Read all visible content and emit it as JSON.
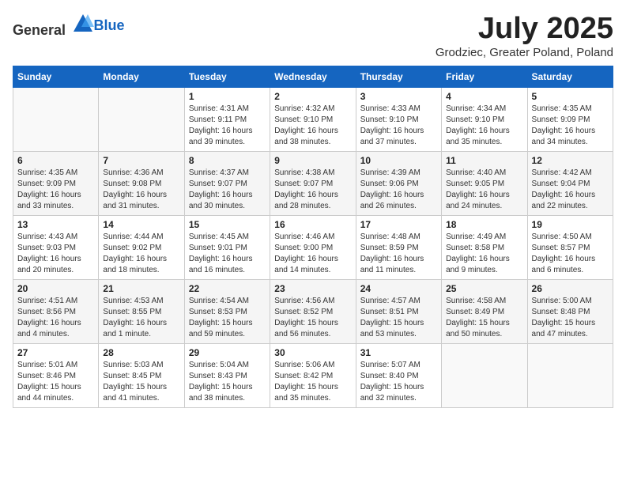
{
  "header": {
    "logo_general": "General",
    "logo_blue": "Blue",
    "month_year": "July 2025",
    "location": "Grodziec, Greater Poland, Poland"
  },
  "days_of_week": [
    "Sunday",
    "Monday",
    "Tuesday",
    "Wednesday",
    "Thursday",
    "Friday",
    "Saturday"
  ],
  "weeks": [
    [
      {
        "day": "",
        "info": ""
      },
      {
        "day": "",
        "info": ""
      },
      {
        "day": "1",
        "info": "Sunrise: 4:31 AM\nSunset: 9:11 PM\nDaylight: 16 hours and 39 minutes."
      },
      {
        "day": "2",
        "info": "Sunrise: 4:32 AM\nSunset: 9:10 PM\nDaylight: 16 hours and 38 minutes."
      },
      {
        "day": "3",
        "info": "Sunrise: 4:33 AM\nSunset: 9:10 PM\nDaylight: 16 hours and 37 minutes."
      },
      {
        "day": "4",
        "info": "Sunrise: 4:34 AM\nSunset: 9:10 PM\nDaylight: 16 hours and 35 minutes."
      },
      {
        "day": "5",
        "info": "Sunrise: 4:35 AM\nSunset: 9:09 PM\nDaylight: 16 hours and 34 minutes."
      }
    ],
    [
      {
        "day": "6",
        "info": "Sunrise: 4:35 AM\nSunset: 9:09 PM\nDaylight: 16 hours and 33 minutes."
      },
      {
        "day": "7",
        "info": "Sunrise: 4:36 AM\nSunset: 9:08 PM\nDaylight: 16 hours and 31 minutes."
      },
      {
        "day": "8",
        "info": "Sunrise: 4:37 AM\nSunset: 9:07 PM\nDaylight: 16 hours and 30 minutes."
      },
      {
        "day": "9",
        "info": "Sunrise: 4:38 AM\nSunset: 9:07 PM\nDaylight: 16 hours and 28 minutes."
      },
      {
        "day": "10",
        "info": "Sunrise: 4:39 AM\nSunset: 9:06 PM\nDaylight: 16 hours and 26 minutes."
      },
      {
        "day": "11",
        "info": "Sunrise: 4:40 AM\nSunset: 9:05 PM\nDaylight: 16 hours and 24 minutes."
      },
      {
        "day": "12",
        "info": "Sunrise: 4:42 AM\nSunset: 9:04 PM\nDaylight: 16 hours and 22 minutes."
      }
    ],
    [
      {
        "day": "13",
        "info": "Sunrise: 4:43 AM\nSunset: 9:03 PM\nDaylight: 16 hours and 20 minutes."
      },
      {
        "day": "14",
        "info": "Sunrise: 4:44 AM\nSunset: 9:02 PM\nDaylight: 16 hours and 18 minutes."
      },
      {
        "day": "15",
        "info": "Sunrise: 4:45 AM\nSunset: 9:01 PM\nDaylight: 16 hours and 16 minutes."
      },
      {
        "day": "16",
        "info": "Sunrise: 4:46 AM\nSunset: 9:00 PM\nDaylight: 16 hours and 14 minutes."
      },
      {
        "day": "17",
        "info": "Sunrise: 4:48 AM\nSunset: 8:59 PM\nDaylight: 16 hours and 11 minutes."
      },
      {
        "day": "18",
        "info": "Sunrise: 4:49 AM\nSunset: 8:58 PM\nDaylight: 16 hours and 9 minutes."
      },
      {
        "day": "19",
        "info": "Sunrise: 4:50 AM\nSunset: 8:57 PM\nDaylight: 16 hours and 6 minutes."
      }
    ],
    [
      {
        "day": "20",
        "info": "Sunrise: 4:51 AM\nSunset: 8:56 PM\nDaylight: 16 hours and 4 minutes."
      },
      {
        "day": "21",
        "info": "Sunrise: 4:53 AM\nSunset: 8:55 PM\nDaylight: 16 hours and 1 minute."
      },
      {
        "day": "22",
        "info": "Sunrise: 4:54 AM\nSunset: 8:53 PM\nDaylight: 15 hours and 59 minutes."
      },
      {
        "day": "23",
        "info": "Sunrise: 4:56 AM\nSunset: 8:52 PM\nDaylight: 15 hours and 56 minutes."
      },
      {
        "day": "24",
        "info": "Sunrise: 4:57 AM\nSunset: 8:51 PM\nDaylight: 15 hours and 53 minutes."
      },
      {
        "day": "25",
        "info": "Sunrise: 4:58 AM\nSunset: 8:49 PM\nDaylight: 15 hours and 50 minutes."
      },
      {
        "day": "26",
        "info": "Sunrise: 5:00 AM\nSunset: 8:48 PM\nDaylight: 15 hours and 47 minutes."
      }
    ],
    [
      {
        "day": "27",
        "info": "Sunrise: 5:01 AM\nSunset: 8:46 PM\nDaylight: 15 hours and 44 minutes."
      },
      {
        "day": "28",
        "info": "Sunrise: 5:03 AM\nSunset: 8:45 PM\nDaylight: 15 hours and 41 minutes."
      },
      {
        "day": "29",
        "info": "Sunrise: 5:04 AM\nSunset: 8:43 PM\nDaylight: 15 hours and 38 minutes."
      },
      {
        "day": "30",
        "info": "Sunrise: 5:06 AM\nSunset: 8:42 PM\nDaylight: 15 hours and 35 minutes."
      },
      {
        "day": "31",
        "info": "Sunrise: 5:07 AM\nSunset: 8:40 PM\nDaylight: 15 hours and 32 minutes."
      },
      {
        "day": "",
        "info": ""
      },
      {
        "day": "",
        "info": ""
      }
    ]
  ]
}
